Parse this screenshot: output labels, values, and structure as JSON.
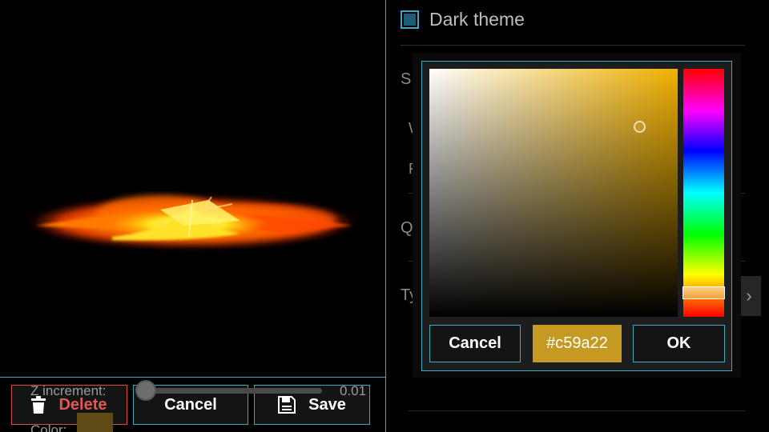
{
  "preview": {
    "effect_icon": "fire-explosion-preview"
  },
  "actions": {
    "delete_label": "Delete",
    "delete_icon": "trash-icon",
    "cancel_label": "Cancel",
    "save_label": "Save",
    "save_icon": "floppy-disk-icon"
  },
  "settings": {
    "dark_theme_label": "Dark theme",
    "dark_theme_checked": true,
    "hidden_labels": [
      "S",
      "W",
      "F",
      "Q",
      "Ty"
    ],
    "z_increment_label": "Z increment:",
    "z_increment_value": "0.01",
    "z_increment_fraction": 0.05,
    "color_label": "Color:",
    "color_value": "#5e4a15"
  },
  "color_picker": {
    "cancel_label": "Cancel",
    "hex_value": "#c59a22",
    "ok_label": "OK",
    "selected_color": "#c59a22",
    "hue_color": "#f0b000"
  },
  "colors": {
    "accent": "#3fa9c4",
    "danger": "#e35656"
  }
}
